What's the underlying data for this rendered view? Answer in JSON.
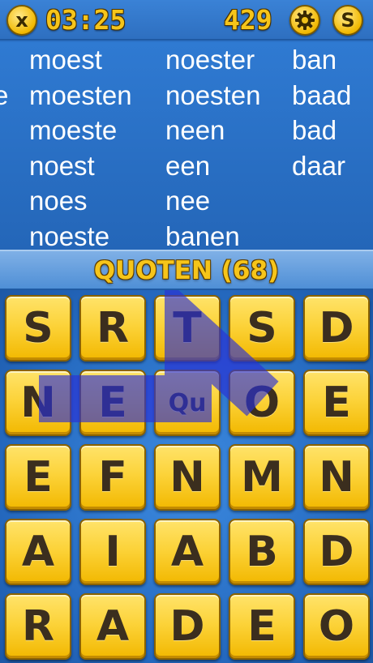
{
  "header": {
    "close_label": "x",
    "timer": "03:25",
    "score": "429",
    "coin_label": "S",
    "accent_color": "#f6c51a"
  },
  "words": {
    "partial": "e",
    "col1": [
      "moest",
      "moesten",
      "moeste",
      "noest",
      "noes",
      "noeste"
    ],
    "col2": [
      "noester",
      "noesten",
      "neen",
      "een",
      "nee",
      "banen"
    ],
    "col3": [
      "ban",
      "baad",
      "bad",
      "daar"
    ]
  },
  "current_word": {
    "text": "QUOTEN (68)"
  },
  "board": {
    "tiles": [
      [
        "S",
        "R",
        "T",
        "S",
        "D"
      ],
      [
        "N",
        "E",
        "Qu",
        "O",
        "E"
      ],
      [
        "E",
        "F",
        "N",
        "M",
        "N"
      ],
      [
        "A",
        "I",
        "A",
        "B",
        "D"
      ],
      [
        "R",
        "A",
        "D",
        "E",
        "O"
      ]
    ],
    "path_color": "#2a2fd6"
  }
}
